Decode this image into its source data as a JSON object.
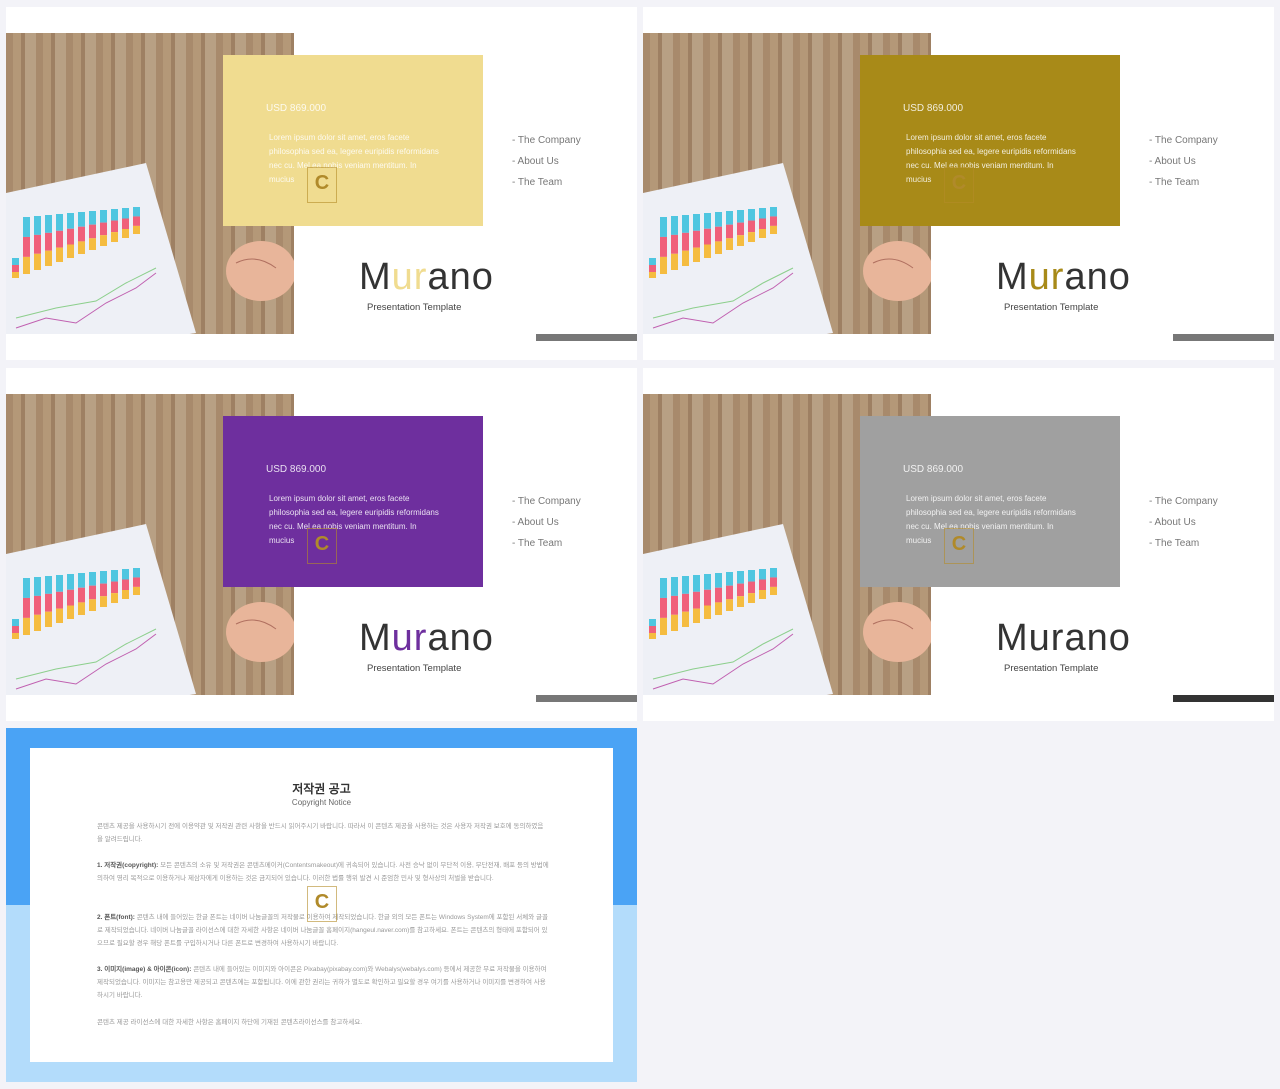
{
  "slides": [
    {
      "accent": "#f0dc90",
      "title_accent": "#f0dc90",
      "bar": "#777777"
    },
    {
      "accent": "#a88a18",
      "title_accent": "#a88a18",
      "bar": "#777777"
    },
    {
      "accent": "#6e2f9e",
      "title_accent": "#6e2f9e",
      "bar": "#777777"
    },
    {
      "accent": "#a0a0a0",
      "title_accent": "#333333",
      "bar": "#333333"
    }
  ],
  "content": {
    "price": "USD 869.000",
    "lorem": "Lorem ipsum dolor sit amet, eros facete philosophia sed ea, legere euripidis reformidans nec cu. Mel ea nobis veniam mentitum. In mucius",
    "menu": [
      "- The Company",
      "- About  Us",
      "- The Team"
    ],
    "title_m": "M",
    "title_ur": "ur",
    "title_ano": "ano",
    "subtitle": "Presentation Template",
    "watermark": "C"
  },
  "copyright": {
    "title": "저작권 공고",
    "subtitle": "Copyright Notice",
    "intro": "콘텐츠 제공을 사용하시기 전에 이용약관 및 저작권 관련 사항을 반드시 읽어주시기 바랍니다. 따라서 이 콘텐츠 제공을 사용하는 것은 사용자 저작권 보호에 동의하였음을 알려드립니다.",
    "p1_label": "1. 저작권(copyright):",
    "p1": " 모든 콘텐츠의 소유 및 저작권은 콘텐츠메이커(Contentsmakeout)에 귀속되어 있습니다. 사전 승낙 없이 무단적 이용, 무단전재, 배포 등의 방법에 의하여 영리 목적으로 이용하거나 제삼자에게 이용하는 것은 금지되어 있습니다. 이러한 법률 행위 발견 시 준엄한 민사 및 형사상의 처벌을 받습니다.",
    "p2_label": "2. 폰트(font):",
    "p2": " 콘텐츠 내에 들어있는 한글 폰트는 네이버 나눔글꼴의 저작물로 이용하여 제작되었습니다. 한글 외의 모든 폰트는 Windows System에 포함된 서체와 글꼴로 제작되었습니다. 네이버 나눔글꼴 라이선스에 대한 자세한 사항은 네이버 나눔글꼴 홈페이지(hangeul.naver.com)를 참고하세요. 폰트는 콘텐츠의 형태에 포함되어 있으므로 필요할 경우 해당 폰트를 구입하시거나 다른 폰트로 변경하여 사용하시기 바랍니다.",
    "p3_label": "3. 이미지(image) & 아이콘(icon):",
    "p3": " 콘텐츠 내에 들어있는 이미지와 아이콘은 Pixabay(pixabay.com)와 Webalys(webalys.com) 등에서 제공한 무료 저작물을 이용하여 제작되었습니다. 이미지는 참고용만 제공되고 콘텐츠에는 포함됩니다. 이에 관한 권리는 귀하가 별도로 확인하고 필요할 경우 여기를 사용하거나 이미지를 변경하여 사용하시기 바랍니다.",
    "outro": "콘텐츠 제공 라이선스에 대한 자세한 사항은 홈페이지 하단에 기재된 콘텐츠라이선스를 참고하세요.",
    "top_color": "#4aa3f5",
    "bottom_color": "#b3dcfb"
  }
}
